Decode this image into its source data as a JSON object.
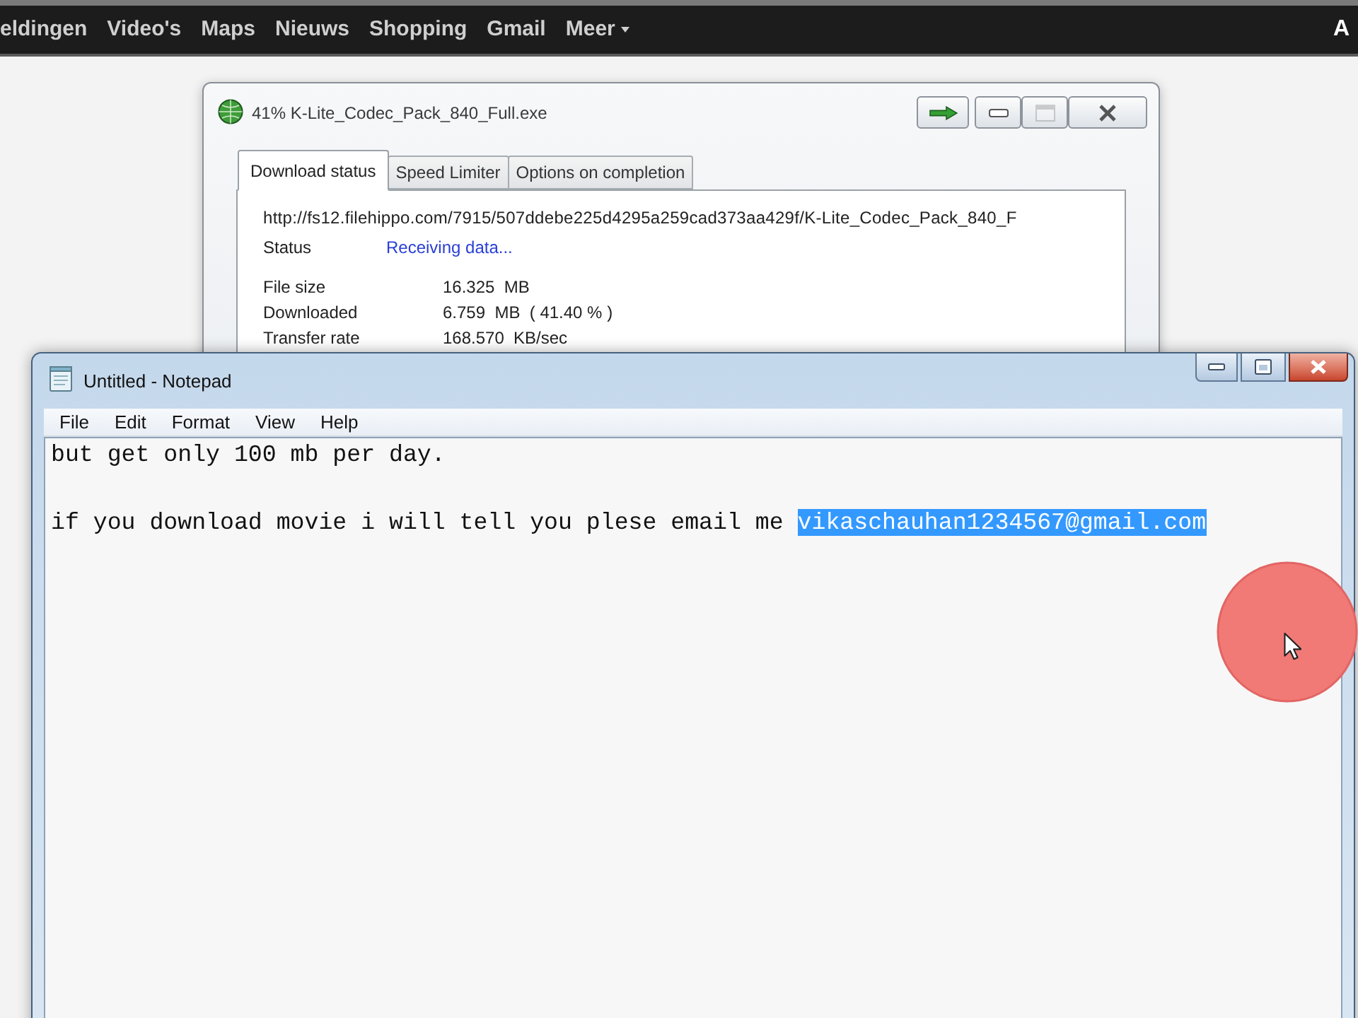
{
  "browser_bar": {
    "links": [
      {
        "label": "eldingen",
        "dropdown": false
      },
      {
        "label": "Video's",
        "dropdown": false
      },
      {
        "label": "Maps",
        "dropdown": false
      },
      {
        "label": "Nieuws",
        "dropdown": false
      },
      {
        "label": "Shopping",
        "dropdown": false
      },
      {
        "label": "Gmail",
        "dropdown": false
      },
      {
        "label": "Meer",
        "dropdown": true
      }
    ],
    "right_text": "A"
  },
  "download_window": {
    "title": "41% K-Lite_Codec_Pack_840_Full.exe",
    "window_buttons": [
      {
        "kind": "arrow",
        "disabled": false
      },
      {
        "kind": "minimize",
        "disabled": false
      },
      {
        "kind": "maximize",
        "disabled": true
      },
      {
        "kind": "close",
        "disabled": false
      }
    ],
    "tabs": [
      {
        "label": "Download status",
        "selected": true
      },
      {
        "label": "Speed Limiter",
        "selected": false
      },
      {
        "label": "Options on completion",
        "selected": false
      }
    ],
    "url": "http://fs12.filehippo.com/7915/507ddebe225d4295a259cad373aa429f/K-Lite_Codec_Pack_840_F",
    "status": {
      "label": "Status",
      "value": "Receiving data..."
    },
    "fields": [
      {
        "label": "File size",
        "value": "16.325  MB"
      },
      {
        "label": "Downloaded",
        "value": "6.759  MB  ( 41.40 % )"
      },
      {
        "label": "Transfer rate",
        "value": "168.570  KB/sec"
      }
    ]
  },
  "notepad": {
    "title": "Untitled - Notepad",
    "window_buttons": [
      {
        "kind": "minimize"
      },
      {
        "kind": "maximize"
      },
      {
        "kind": "close"
      }
    ],
    "menu": [
      "File",
      "Edit",
      "Format",
      "View",
      "Help"
    ],
    "text_segments": [
      {
        "text": "but get only 100 mb per day.\n\nif you download movie i will tell you plese email me ",
        "selected": false
      },
      {
        "text": "vikaschauhan1234567@gmail.com",
        "selected": true
      }
    ]
  }
}
